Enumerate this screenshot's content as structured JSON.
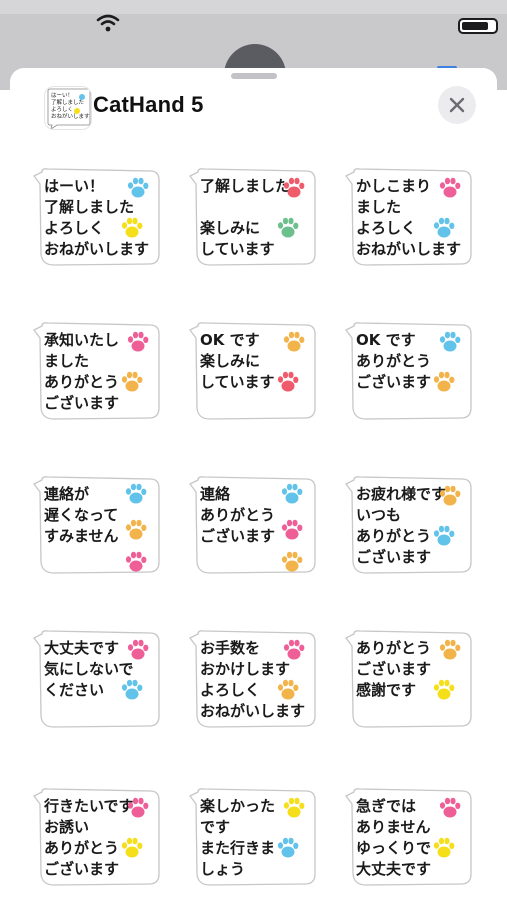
{
  "app": {
    "title": "CatHand 5",
    "thumb_text": [
      "はーい！",
      "了解しました",
      "よろしく",
      "おねがいします"
    ]
  },
  "colors": {
    "blue": "#62c3ea",
    "pink": "#ee5f98",
    "orange": "#f2b34a",
    "yellow": "#f5df1a",
    "green": "#6cc08c",
    "red": "#ef5b6b"
  },
  "icons": {
    "status": [
      "wifi-icon",
      "battery-icon"
    ],
    "close": "close-icon",
    "paw": "paw-icon"
  },
  "stickers": [
    {
      "lines": [
        "はーい！",
        "了解しました",
        "よろしく",
        "おねがいします"
      ],
      "paws": [
        "blue",
        "yellow"
      ]
    },
    {
      "lines": [
        "了解しました",
        "",
        "楽しみに",
        "しています"
      ],
      "paws": [
        "red",
        "green"
      ]
    },
    {
      "lines": [
        "かしこまり",
        "ました",
        "よろしく",
        "おねがいします"
      ],
      "paws": [
        "pink",
        "blue"
      ]
    },
    {
      "lines": [
        "承知いたし",
        "ました",
        "ありがとう",
        "ございます"
      ],
      "paws": [
        "pink",
        "orange"
      ]
    },
    {
      "lines": [
        "OK です",
        "楽しみに",
        "しています"
      ],
      "paws": [
        "orange",
        "red"
      ]
    },
    {
      "lines": [
        "OK です",
        "ありがとう",
        "ございます"
      ],
      "paws": [
        "blue",
        "orange"
      ]
    },
    {
      "lines": [
        "連絡が",
        "遅くなって",
        "すみません"
      ],
      "paws": [
        "blue",
        "orange",
        "pink"
      ]
    },
    {
      "lines": [
        "連絡",
        "ありがとう",
        "ございます"
      ],
      "paws": [
        "blue",
        "pink",
        "orange"
      ]
    },
    {
      "lines": [
        "お疲れ様です",
        "いつも",
        "ありがとう",
        "ございます"
      ],
      "paws": [
        "orange",
        "blue"
      ]
    },
    {
      "lines": [
        "大丈夫です",
        "気にしないで",
        "ください"
      ],
      "paws": [
        "pink",
        "blue"
      ]
    },
    {
      "lines": [
        "お手数を",
        "おかけします",
        "よろしく",
        "おねがいします"
      ],
      "paws": [
        "pink",
        "orange"
      ]
    },
    {
      "lines": [
        "ありがとう",
        "ございます",
        "感謝です"
      ],
      "paws": [
        "orange",
        "yellow"
      ]
    },
    {
      "lines": [
        "行きたいです",
        "お誘い",
        "ありがとう",
        "ございます"
      ],
      "paws": [
        "pink",
        "yellow"
      ]
    },
    {
      "lines": [
        "楽しかった",
        "です",
        "また行きま",
        "しょう"
      ],
      "paws": [
        "yellow",
        "blue"
      ]
    },
    {
      "lines": [
        "急ぎでは",
        "ありません",
        "ゆっくりで",
        "大丈夫です"
      ],
      "paws": [
        "pink",
        "yellow"
      ]
    }
  ]
}
